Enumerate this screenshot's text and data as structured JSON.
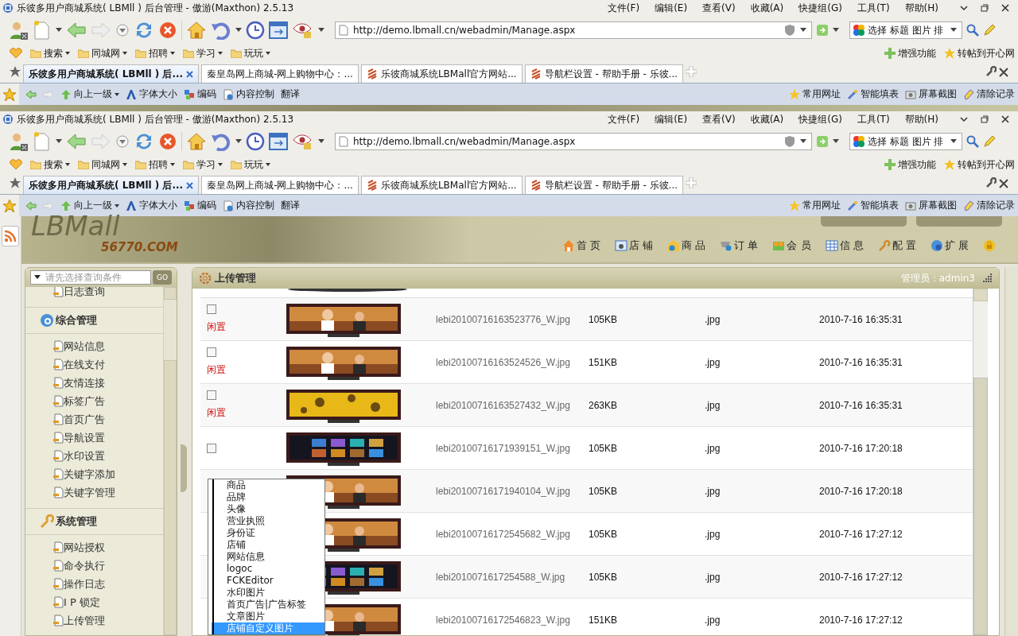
{
  "browser_windows": [
    {
      "title": "乐彼多用户商城系统( LBMll ) 后台管理 - 傲游(Maxthon) 2.5.13",
      "menu": [
        "文件(F)",
        "编辑(E)",
        "查看(V)",
        "收藏(A)",
        "快捷组(G)",
        "工具(T)",
        "帮助(H)"
      ],
      "address": "http://demo.lbmall.cn/webadmin/Manage.aspx",
      "search_box": "选择 标题 图片 排",
      "bookmarks": [
        "搜索",
        "同城网",
        "招聘",
        "学习",
        "玩玩"
      ],
      "bookmark_tools": [
        "增强功能",
        "转帖到开心网"
      ],
      "tabs": [
        {
          "label": "乐彼多用户商城系统( LBMll ) 后...",
          "selected": true
        },
        {
          "label": "秦皇岛网上商城-网上购物中心：...",
          "selected": false
        },
        {
          "label": "乐彼商城系统LBMall官方网站...",
          "selected": false
        },
        {
          "label": "导航栏设置 - 帮助手册 - 乐彼...",
          "selected": false
        }
      ],
      "sub_tools": [
        "向上一级",
        "字体大小",
        "编码",
        "内容控制",
        "翻译"
      ],
      "sub_tools_right": [
        "常用网址",
        "智能填表",
        "屏幕截图",
        "清除记录"
      ]
    },
    {
      "title": "乐彼多用户商城系统( LBMll ) 后台管理 - 傲游(Maxthon) 2.5.13",
      "menu": [
        "文件(F)",
        "编辑(E)",
        "查看(V)",
        "收藏(A)",
        "快捷组(G)",
        "工具(T)",
        "帮助(H)"
      ],
      "address": "http://demo.lbmall.cn/webadmin/Manage.aspx",
      "search_box": "选择 标题 图片 排",
      "bookmarks": [
        "搜索",
        "同城网",
        "招聘",
        "学习",
        "玩玩"
      ],
      "bookmark_tools": [
        "增强功能",
        "转帖到开心网"
      ],
      "tabs": [
        {
          "label": "乐彼多用户商城系统( LBMll ) 后...",
          "selected": true
        },
        {
          "label": "秦皇岛网上商城-网上购物中心：...",
          "selected": false
        },
        {
          "label": "乐彼商城系统LBMall官方网站...",
          "selected": false
        },
        {
          "label": "导航栏设置 - 帮助手册 - 乐彼...",
          "selected": false
        }
      ],
      "sub_tools": [
        "向上一级",
        "字体大小",
        "编码",
        "内容控制",
        "翻译"
      ],
      "sub_tools_right": [
        "常用网址",
        "智能填表",
        "屏幕截图",
        "清除记录"
      ]
    }
  ],
  "header": {
    "logo": "LBMall",
    "logo_sub": "56770.COM",
    "nav": [
      "首 页",
      "店 铺",
      "商 品",
      "订 单",
      "会 员",
      "信 息",
      "配 置",
      "扩 展"
    ]
  },
  "sidebar": {
    "query_select": {
      "placeholder": "请先选择查询条件"
    },
    "go_button": "GO",
    "groups": [
      {
        "items": [
          "日志查询"
        ]
      },
      {
        "title": "综合管理",
        "items": [
          "网站信息",
          "在线支付",
          "友情连接",
          "标签广告",
          "首页广告",
          "导航设置",
          "水印设置",
          "关键字添加",
          "关键字管理"
        ]
      },
      {
        "title": "系统管理",
        "items": [
          "网站授权",
          "命令执行",
          "操作日志",
          "I P 锁定",
          "上传管理"
        ]
      }
    ]
  },
  "main": {
    "title": "上传管理",
    "admin": "管理员：admin3",
    "rows": [
      {
        "checked": false,
        "status": "闲置",
        "file": "lebi20100716163523776_W.jpg",
        "size": "105KB",
        "type": ".jpg",
        "date": "2010-7-16 16:35:31"
      },
      {
        "checked": false,
        "status": "闲置",
        "file": "lebi20100716163524526_W.jpg",
        "size": "151KB",
        "type": ".jpg",
        "date": "2010-7-16 16:35:31"
      },
      {
        "checked": false,
        "status": "闲置",
        "file": "lebi20100716163527432_W.jpg",
        "size": "263KB",
        "type": ".jpg",
        "date": "2010-7-16 16:35:31"
      },
      {
        "checked": false,
        "file": "lebi20100716171939151_W.jpg",
        "size": "105KB",
        "type": ".jpg",
        "date": "2010-7-16 17:20:18"
      },
      {
        "file": "lebi20100716171940104_W.jpg",
        "size": "105KB",
        "type": ".jpg",
        "date": "2010-7-16 17:20:18"
      },
      {
        "file": "lebi20100716172545682_W.jpg",
        "size": "105KB",
        "type": ".jpg",
        "date": "2010-7-16 17:27:12"
      },
      {
        "file": "lebi2010071617254588_W.jpg",
        "size": "105KB",
        "type": ".jpg",
        "date": "2010-7-16 17:27:12"
      },
      {
        "file": "lebi20100716172546823_W.jpg",
        "size": "151KB",
        "type": ".jpg",
        "date": "2010-7-16 17:27:12"
      }
    ],
    "dropdown": [
      {
        "label": "商品",
        "selected": false
      },
      {
        "label": "品牌",
        "selected": false
      },
      {
        "label": "头像",
        "selected": false
      },
      {
        "label": "营业执照",
        "selected": false
      },
      {
        "label": "身份证",
        "selected": false
      },
      {
        "label": "店铺",
        "selected": false
      },
      {
        "label": "网站信息",
        "selected": false
      },
      {
        "label": "logoc",
        "selected": false
      },
      {
        "label": "FCKEditor",
        "selected": false
      },
      {
        "label": "水印图片",
        "selected": false
      },
      {
        "label": "首页广告|广告标签",
        "selected": false
      },
      {
        "label": "文章图片",
        "selected": false
      },
      {
        "label": "店铺自定义图片",
        "selected": true
      }
    ]
  }
}
